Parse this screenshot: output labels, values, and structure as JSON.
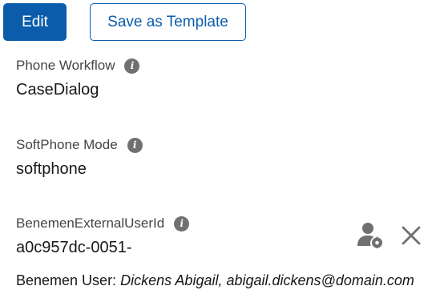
{
  "toolbar": {
    "edit_label": "Edit",
    "save_template_label": "Save as Template"
  },
  "fields": [
    {
      "label": "Phone Workflow",
      "value": "CaseDialog"
    },
    {
      "label": "SoftPhone Mode",
      "value": "softphone"
    },
    {
      "label": "BenemenExternalUserId",
      "value": "a0c957dc-0051-"
    }
  ],
  "info_icon_glyph": "i",
  "footer": {
    "label": "Benemen User:",
    "value": "Dickens Abigail, abigail.dickens@domain.com"
  },
  "icons": [
    "info-icon",
    "user-settings-icon",
    "close-icon"
  ],
  "colors": {
    "brand": "#0b5cab",
    "icon_gray": "#707070",
    "label_gray": "#444444",
    "text": "#181818"
  }
}
